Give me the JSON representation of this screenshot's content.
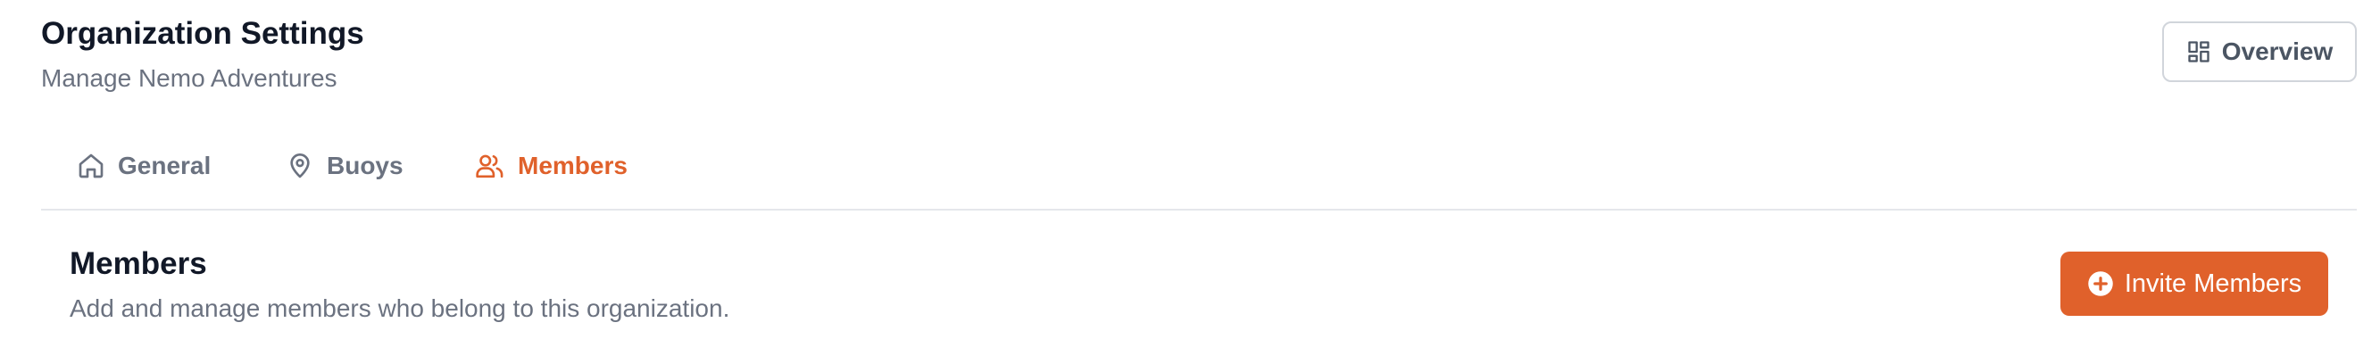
{
  "header": {
    "title": "Organization Settings",
    "subtitle": "Manage Nemo Adventures",
    "overview_button": {
      "label": "Overview",
      "icon": "dashboard-icon"
    }
  },
  "tabs": [
    {
      "label": "General",
      "icon": "home-icon",
      "active": false
    },
    {
      "label": "Buoys",
      "icon": "map-pin-icon",
      "active": false
    },
    {
      "label": "Members",
      "icon": "users-icon",
      "active": true
    }
  ],
  "members_section": {
    "title": "Members",
    "description": "Add and manage members who belong to this organization.",
    "invite_button": {
      "label": "Invite Members",
      "icon": "plus-circle-icon"
    }
  },
  "colors": {
    "accent": "#e0612b",
    "text_primary": "#111827",
    "text_muted": "#6b7280",
    "border": "#e5e7eb"
  }
}
